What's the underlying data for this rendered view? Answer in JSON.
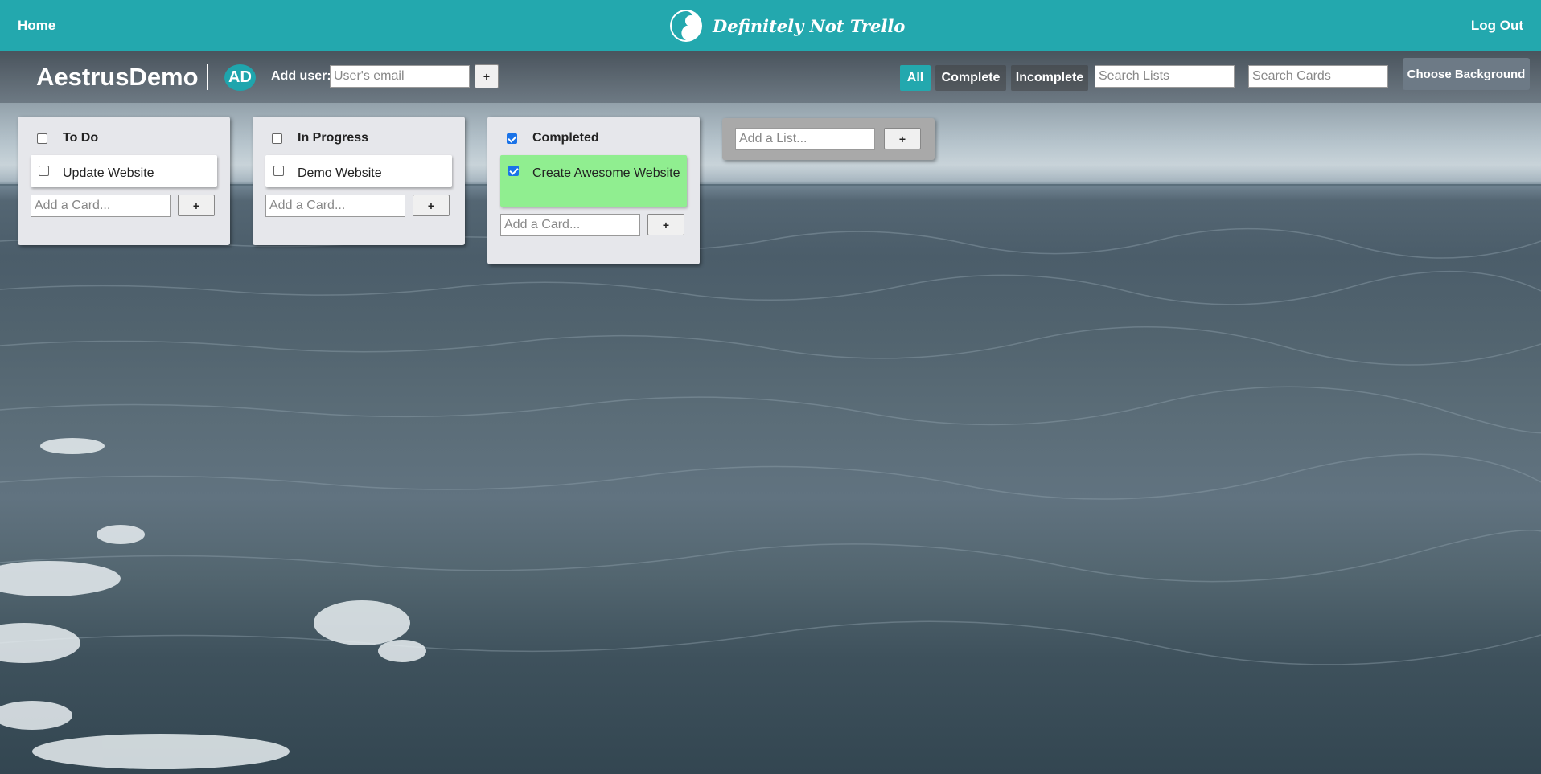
{
  "nav": {
    "home": "Home",
    "brand": "Definitely Not Trello",
    "logout": "Log Out"
  },
  "board": {
    "title": "AestrusDemo",
    "avatar_initials": "AD",
    "add_user_label": "Add user:",
    "add_user_placeholder": "User's email",
    "add_button": "+",
    "filters": [
      "All",
      "Complete",
      "Incomplete"
    ],
    "active_filter": "All",
    "search_lists_placeholder": "Search Lists",
    "search_cards_placeholder": "Search Cards",
    "choose_background": "Choose Background"
  },
  "lists": [
    {
      "title": "To Do",
      "checked": false,
      "cards": [
        {
          "text": "Update Website",
          "checked": false
        }
      ],
      "add_card_placeholder": "Add a Card...",
      "add_button": "+"
    },
    {
      "title": "In Progress",
      "checked": false,
      "cards": [
        {
          "text": "Demo Website",
          "checked": false
        }
      ],
      "add_card_placeholder": "Add a Card...",
      "add_button": "+"
    },
    {
      "title": "Completed",
      "checked": true,
      "cards": [
        {
          "text": "Create Awesome Website",
          "checked": true
        }
      ],
      "add_card_placeholder": "Add a Card...",
      "add_button": "+"
    }
  ],
  "add_list": {
    "placeholder": "Add a List...",
    "button": "+"
  },
  "colors": {
    "accent": "#23a8ae",
    "completed_card": "#90ee90",
    "list_bg": "#e6e7eb"
  }
}
